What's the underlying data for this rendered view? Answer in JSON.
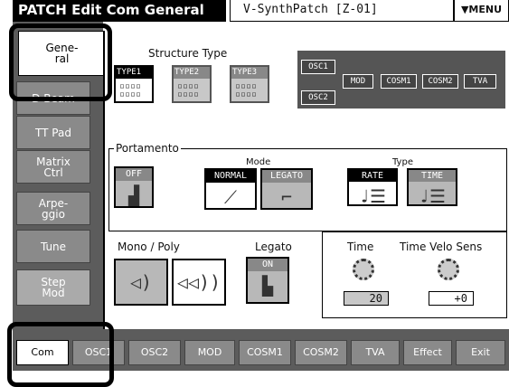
{
  "header": {
    "title": "PATCH Edit Com General",
    "patch_name": "V-SynthPatch [Z-01]",
    "menu_label": "▼MENU"
  },
  "side_tabs": [
    {
      "label": "Gene-\nral",
      "active": true
    },
    {
      "label": "D Beam",
      "active": false
    },
    {
      "label": "TT Pad",
      "active": false
    },
    {
      "label": "Matrix\nCtrl",
      "active": false
    },
    {
      "label": "Arpe-\nggio",
      "active": false
    },
    {
      "label": "Tune",
      "active": false
    },
    {
      "label": "Step\nMod",
      "active": false
    }
  ],
  "structure": {
    "label": "Structure Type",
    "types": [
      {
        "label": "TYPE1",
        "selected": true
      },
      {
        "label": "TYPE2",
        "selected": false
      },
      {
        "label": "TYPE3",
        "selected": false
      }
    ],
    "diagram": [
      "OSC1",
      "OSC2",
      "MOD",
      "COSM1",
      "COSM2",
      "TVA"
    ]
  },
  "portamento": {
    "label": "Portamento",
    "switch": "OFF",
    "mode_label": "Mode",
    "modes": [
      {
        "label": "NORMAL",
        "selected": true
      },
      {
        "label": "LEGATO",
        "selected": false
      }
    ],
    "type_label": "Type",
    "types": [
      {
        "label": "RATE",
        "selected": true
      },
      {
        "label": "TIME",
        "selected": false
      }
    ],
    "time_label": "Time",
    "time_value": "20",
    "velo_label": "Time Velo Sens",
    "velo_value": "+0"
  },
  "mono_poly": {
    "label": "Mono / Poly",
    "selected": "poly"
  },
  "legato": {
    "label": "Legato",
    "switch": "ON"
  },
  "bottom_tabs": [
    {
      "label": "Com",
      "active": true
    },
    {
      "label": "OSC1",
      "active": false
    },
    {
      "label": "OSC2",
      "active": false
    },
    {
      "label": "MOD",
      "active": false
    },
    {
      "label": "COSM1",
      "active": false
    },
    {
      "label": "COSM2",
      "active": false
    },
    {
      "label": "TVA",
      "active": false
    },
    {
      "label": "Effect",
      "active": false
    },
    {
      "label": "Exit",
      "active": false
    }
  ],
  "colors": {
    "panel_dark": "#5c5c5c",
    "tab_inactive": "#8a8a8a",
    "highlight": "#000000"
  }
}
